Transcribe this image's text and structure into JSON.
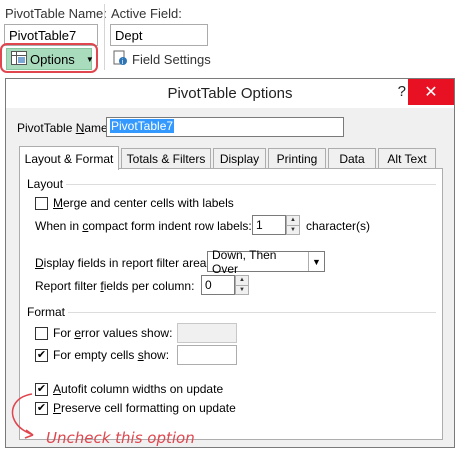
{
  "ribbon": {
    "pivot_name_label": "PivotTable Name:",
    "pivot_name_value": "PivotTable7",
    "active_field_label": "Active Field:",
    "active_field_value": "Dept",
    "options_button_label": "Options",
    "field_settings_label": "Field Settings"
  },
  "dialog": {
    "title": "PivotTable Options",
    "help_glyph": "?",
    "close_glyph": "✕",
    "name_label": "PivotTable Name:",
    "name_value": "PivotTable7",
    "tabs": [
      {
        "label": "Layout & Format",
        "active": true
      },
      {
        "label": "Totals & Filters"
      },
      {
        "label": "Display"
      },
      {
        "label": "Printing"
      },
      {
        "label": "Data"
      },
      {
        "label": "Alt Text"
      }
    ],
    "layout": {
      "section_title": "Layout",
      "merge_label": "Merge and center cells with labels",
      "merge_checked": false,
      "indent_label": "When in compact form indent row labels:",
      "indent_value": "1",
      "indent_unit": "character(s)",
      "filter_area_label": "Display fields in report filter area:",
      "filter_area_value": "Down, Then Over",
      "filter_fields_label": "Report filter fields per column:",
      "filter_fields_value": "0"
    },
    "format": {
      "section_title": "Format",
      "error_values_label": "For error values show:",
      "error_values_checked": false,
      "error_values_value": "",
      "empty_cells_label": "For empty cells show:",
      "empty_cells_checked": true,
      "empty_cells_value": "",
      "autofit_label": "Autofit column widths on update",
      "autofit_checked": true,
      "preserve_label": "Preserve cell formatting on update",
      "preserve_checked": true
    }
  },
  "annotation": {
    "text": "Uncheck this option",
    "color": "#e0464e"
  },
  "colors": {
    "options_button": "#a9dbbd",
    "highlight_outline": "#e0464e",
    "close_button": "#e81123",
    "selection": "#3399ff"
  }
}
